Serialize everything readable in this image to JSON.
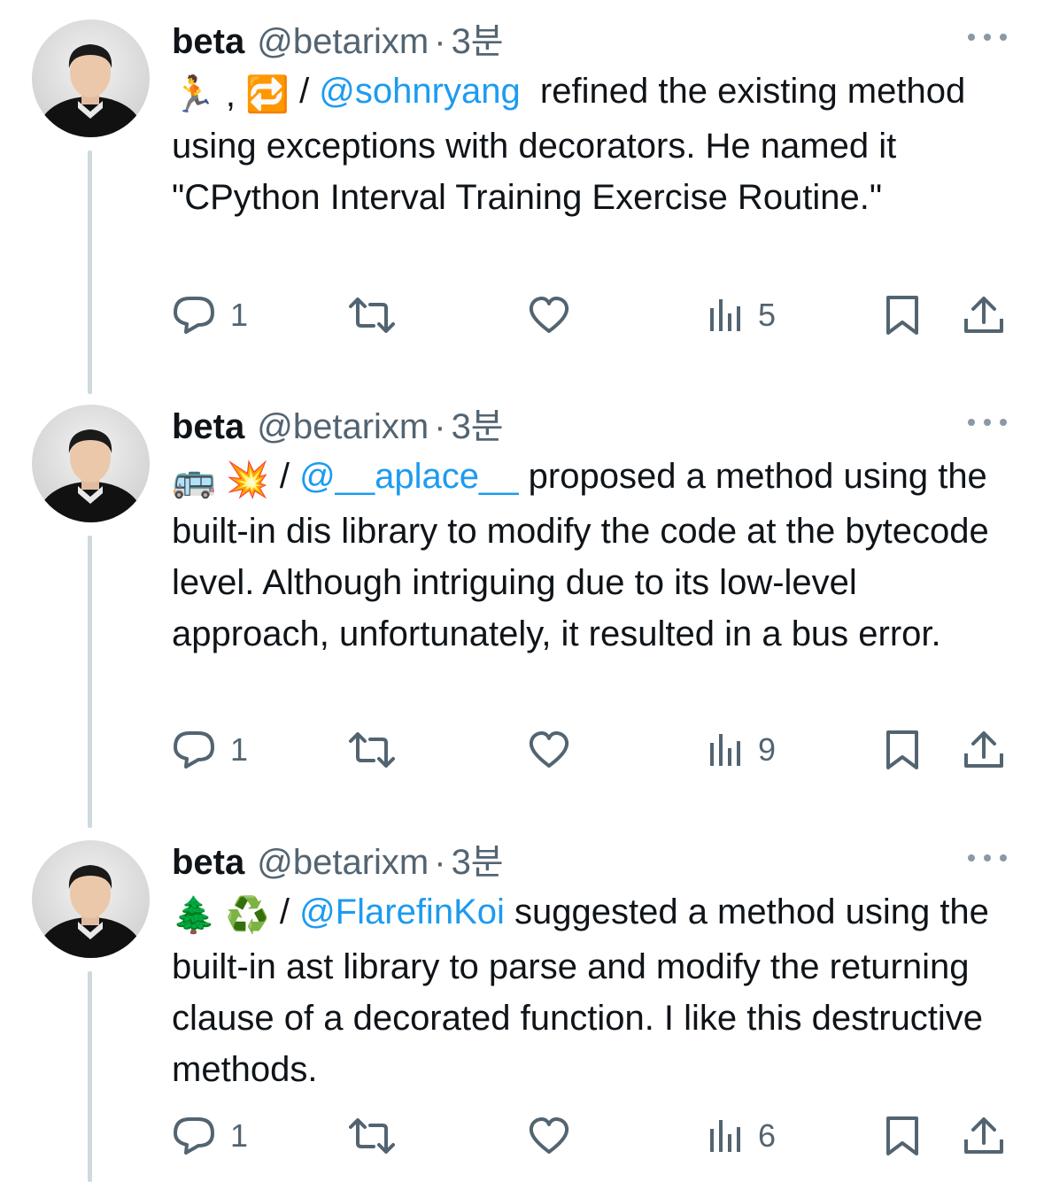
{
  "tweets": [
    {
      "name": "beta",
      "handle": "@betarixm",
      "dot": "·",
      "time": "3분",
      "emoji": "🏃 , 🔁",
      "slash": " / ",
      "mention": "@sohnryang",
      "text": "  refined the existing method using exceptions with decorators. He named it \"CPython Interval Training Exercise Routine.\"",
      "replies": "1",
      "views": "5"
    },
    {
      "name": "beta",
      "handle": "@betarixm",
      "dot": "·",
      "time": "3분",
      "emoji": "🚌 💥",
      "slash": " / ",
      "mention": "@__aplace__",
      "text": " proposed a method using the built-in dis library to modify the code at the bytecode level. Although intriguing due to its low-level approach, unfortunately, it resulted in a bus error.",
      "replies": "1",
      "views": "9"
    },
    {
      "name": "beta",
      "handle": "@betarixm",
      "dot": "·",
      "time": "3분",
      "emoji": "🌲 ♻️",
      "slash": " / ",
      "mention": "@FlarefinKoi",
      "text": " suggested a method using the built-in ast library to parse and modify the returning clause of a decorated function. I like this destructive methods.",
      "replies": "1",
      "views": "6"
    }
  ],
  "icons": {
    "reply": "reply-icon",
    "retweet": "retweet-icon",
    "like": "heart-icon",
    "views": "views-icon",
    "bookmark": "bookmark-icon",
    "share": "share-icon",
    "more": "more-icon"
  },
  "colors": {
    "text": "#0f1419",
    "secondary": "#536471",
    "link": "#1d9bf0",
    "thread_line": "#cfd9de"
  }
}
